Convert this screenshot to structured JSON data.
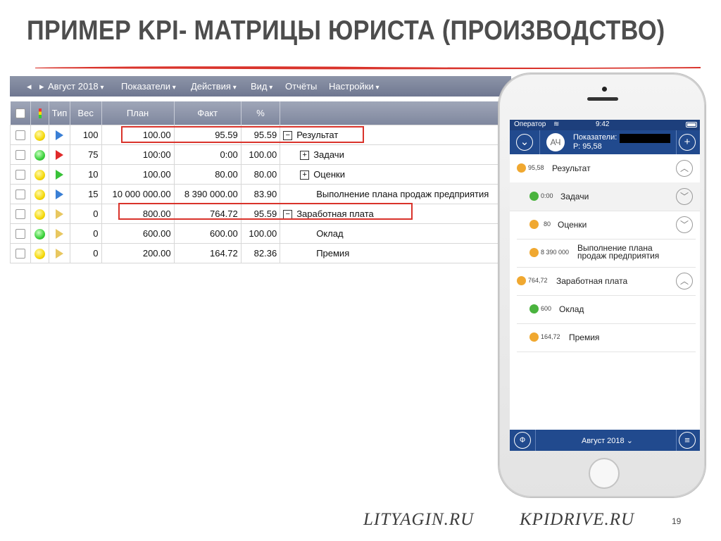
{
  "slide": {
    "title": "ПРИМЕР KPI- МАТРИЦЫ ЮРИСТА (ПРОИЗВОДСТВО)",
    "footer_left": "LITYAGIN.RU",
    "footer_right": "KPIDRIVE.RU",
    "page_number": "19",
    "accent_color": "#d9332b"
  },
  "desktop": {
    "menu": {
      "period": "Август 2018",
      "items": [
        "Показатели",
        "Действия",
        "Вид",
        "Отчёты",
        "Настройки"
      ]
    },
    "columns": {
      "type": "Тип",
      "weight": "Вес",
      "plan": "План",
      "fact": "Факт",
      "percent": "%"
    },
    "rows": [
      {
        "status": "yellow",
        "type": "blue",
        "weight": "100",
        "plan": "100.00",
        "fact": "95.59",
        "percent": "95.59",
        "toggle": "−",
        "name": "Результат"
      },
      {
        "status": "green",
        "type": "red",
        "weight": "75",
        "plan": "100:00",
        "fact": "0:00",
        "percent": "100.00",
        "toggle": "+",
        "name": "Задачи"
      },
      {
        "status": "yellow",
        "type": "green",
        "weight": "10",
        "plan": "100.00",
        "fact": "80.00",
        "percent": "80.00",
        "toggle": "+",
        "name": "Оценки"
      },
      {
        "status": "yellow",
        "type": "blue",
        "weight": "15",
        "plan": "10 000 000.00",
        "fact": "8 390 000.00",
        "percent": "83.90",
        "toggle": "",
        "name": "Выполнение плана продаж предприятия"
      },
      {
        "status": "yellow",
        "type": "gold",
        "weight": "0",
        "plan": "800.00",
        "fact": "764.72",
        "percent": "95.59",
        "toggle": "−",
        "name": "Заработная плата"
      },
      {
        "status": "green",
        "type": "gold",
        "weight": "0",
        "plan": "600.00",
        "fact": "600.00",
        "percent": "100.00",
        "toggle": "",
        "name": "Оклад"
      },
      {
        "status": "yellow",
        "type": "gold",
        "weight": "0",
        "plan": "200.00",
        "fact": "164.72",
        "percent": "82.36",
        "toggle": "",
        "name": "Премия"
      }
    ]
  },
  "mobile": {
    "status": {
      "carrier": "Оператор",
      "wifi": "wifi-icon",
      "time": "9:42"
    },
    "header": {
      "avatar": "АЧ",
      "label": "Показатели:",
      "score": "Р: 95,58"
    },
    "items": [
      {
        "dot": "orange",
        "value": "95,58",
        "name": "Результат",
        "chevron": "up"
      },
      {
        "dot": "green",
        "value": "0:00",
        "name": "Задачи",
        "chevron": "down"
      },
      {
        "dot": "orange",
        "value": "80",
        "name": "Оценки",
        "chevron": "down"
      },
      {
        "dot": "orange",
        "value": "8 390 000",
        "name_line1": "Выполнение плана",
        "name_line2": "продаж предприятия"
      },
      {
        "dot": "orange",
        "value": "764,72",
        "name": "Заработная плата",
        "chevron": "up"
      },
      {
        "dot": "green",
        "value": "600",
        "name": "Оклад"
      },
      {
        "dot": "orange",
        "value": "164,72",
        "name": "Премия"
      }
    ],
    "footer": {
      "filter_icon": "Ф",
      "period": "Август 2018"
    }
  }
}
